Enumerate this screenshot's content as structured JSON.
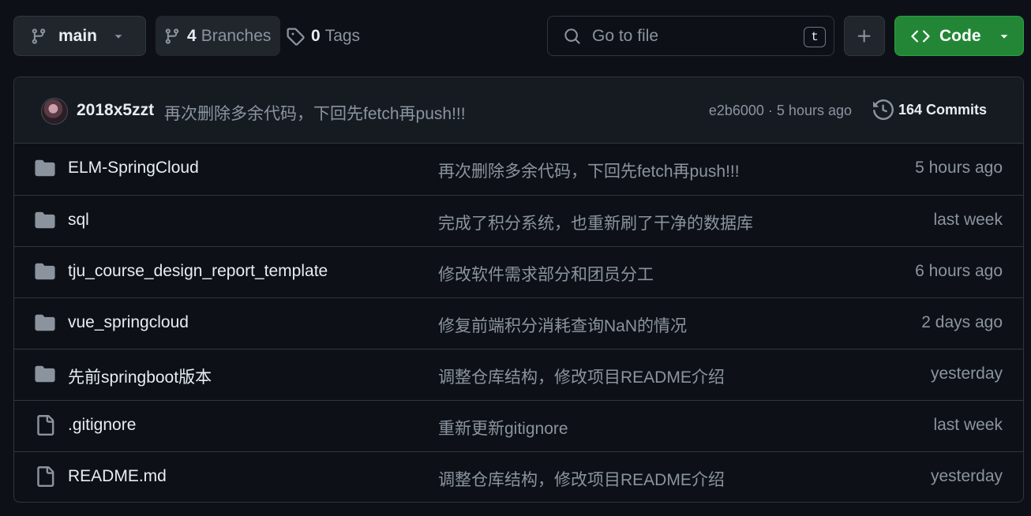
{
  "toolbar": {
    "branch_label": "main",
    "branches_count": "4",
    "branches_label": "Branches",
    "tags_count": "0",
    "tags_label": "Tags",
    "search_placeholder": "Go to file",
    "search_shortcut": "t",
    "code_label": "Code"
  },
  "commit": {
    "author": "2018x5zzt",
    "message": "再次删除多余代码，下回先fetch再push!!!",
    "meta": "e2b6000 · 5 hours ago",
    "commits_label": "164 Commits"
  },
  "files": [
    {
      "name": "ELM-SpringCloud",
      "type": "folder",
      "message": "再次删除多余代码，下回先fetch再push!!!",
      "time": "5 hours ago"
    },
    {
      "name": "sql",
      "type": "folder",
      "message": "完成了积分系统，也重新刷了干净的数据库",
      "time": "last week"
    },
    {
      "name": "tju_course_design_report_template",
      "type": "folder",
      "message": "修改软件需求部分和团员分工",
      "time": "6 hours ago"
    },
    {
      "name": "vue_springcloud",
      "type": "folder",
      "message": "修复前端积分消耗查询NaN的情况",
      "time": "2 days ago"
    },
    {
      "name": "先前springboot版本",
      "type": "folder",
      "message": "调整仓库结构，修改项目README介绍",
      "time": "yesterday"
    },
    {
      "name": ".gitignore",
      "type": "file",
      "message": "重新更新gitignore",
      "time": "last week"
    },
    {
      "name": "README.md",
      "type": "file",
      "message": "调整仓库结构，修改项目README介绍",
      "time": "yesterday"
    }
  ],
  "colors": {
    "background": "#0d1117",
    "header_bg": "#161b22",
    "border": "#30363d",
    "code_button": "#238636",
    "text": "#e6edf3",
    "muted_text": "#8b949e"
  }
}
